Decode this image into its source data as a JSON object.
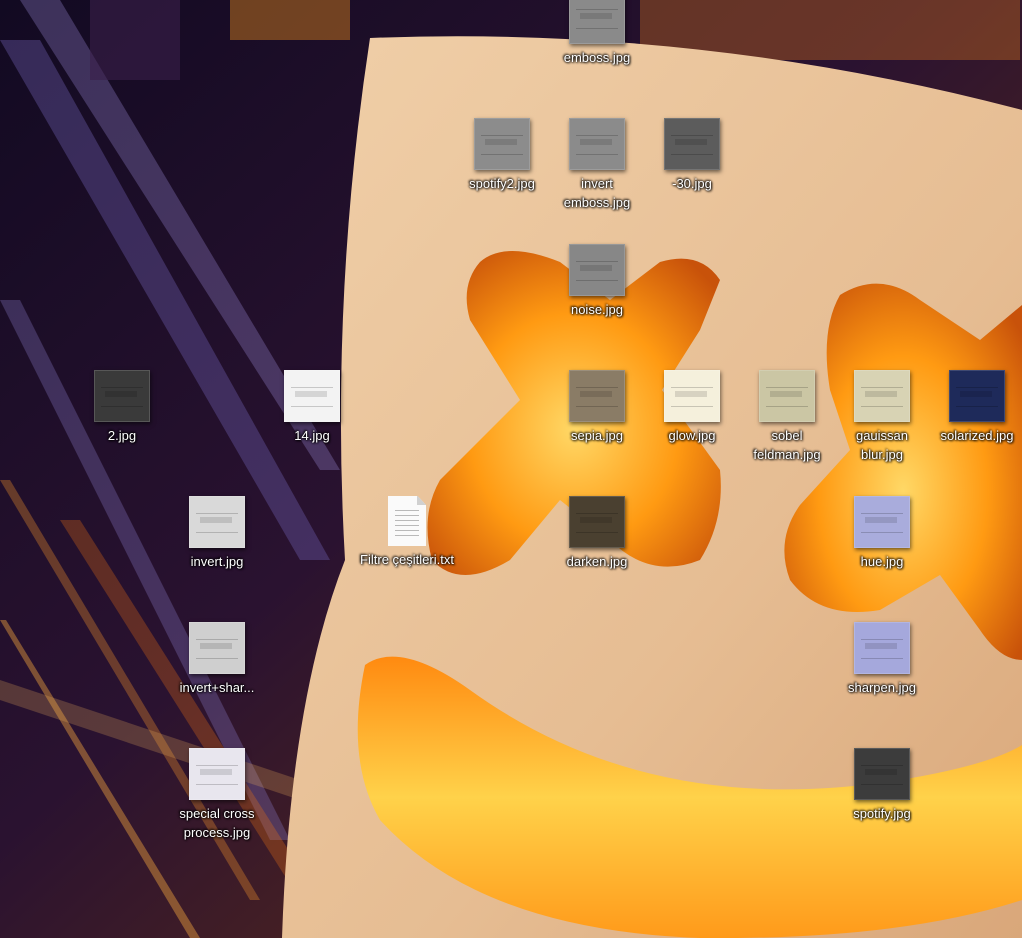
{
  "icons": [
    {
      "label": "emboss.jpg",
      "thumb": "#8a8a8a",
      "kind": "image"
    },
    {
      "label": "spotify2.jpg",
      "thumb": "#8c8c8c",
      "kind": "image"
    },
    {
      "label": "invert emboss.jpg",
      "thumb": "#8b8b8b",
      "kind": "image"
    },
    {
      "label": "-30.jpg",
      "thumb": "#5c5c5c",
      "kind": "image"
    },
    {
      "label": "noise.jpg",
      "thumb": "#878787",
      "kind": "image"
    },
    {
      "label": "2.jpg",
      "thumb": "#3a3a3a",
      "kind": "image"
    },
    {
      "label": "14.jpg",
      "thumb": "#f3f3f3",
      "kind": "image"
    },
    {
      "label": "sepia.jpg",
      "thumb": "#8a7c66",
      "kind": "image"
    },
    {
      "label": "glow.jpg",
      "thumb": "#f5f0dc",
      "kind": "image"
    },
    {
      "label": "sobel feldman.jpg",
      "thumb": "#cbc6a4",
      "kind": "image"
    },
    {
      "label": "gauissan blur.jpg",
      "thumb": "#d8d3b4",
      "kind": "image"
    },
    {
      "label": "solarized.jpg",
      "thumb": "#1e2a5a",
      "kind": "image"
    },
    {
      "label": "invert.jpg",
      "thumb": "#d9d9d9",
      "kind": "image"
    },
    {
      "label": "Filtre çeşitleri.txt",
      "thumb": "#fafafa",
      "kind": "text"
    },
    {
      "label": "darken.jpg",
      "thumb": "#4a4030",
      "kind": "image"
    },
    {
      "label": "hue.jpg",
      "thumb": "#a9acdc",
      "kind": "image"
    },
    {
      "label": "invert+shar...",
      "thumb": "#cfcfcf",
      "kind": "image"
    },
    {
      "label": "sharpen.jpg",
      "thumb": "#a5a8dc",
      "kind": "image"
    },
    {
      "label": "special cross process.jpg",
      "thumb": "#e8e6ee",
      "kind": "image"
    },
    {
      "label": "spotify.jpg",
      "thumb": "#3c3c3c",
      "kind": "image"
    }
  ],
  "colors": {
    "mask": "#e9c29a",
    "glow": "#ffb21a",
    "background": "#1a0e20"
  }
}
